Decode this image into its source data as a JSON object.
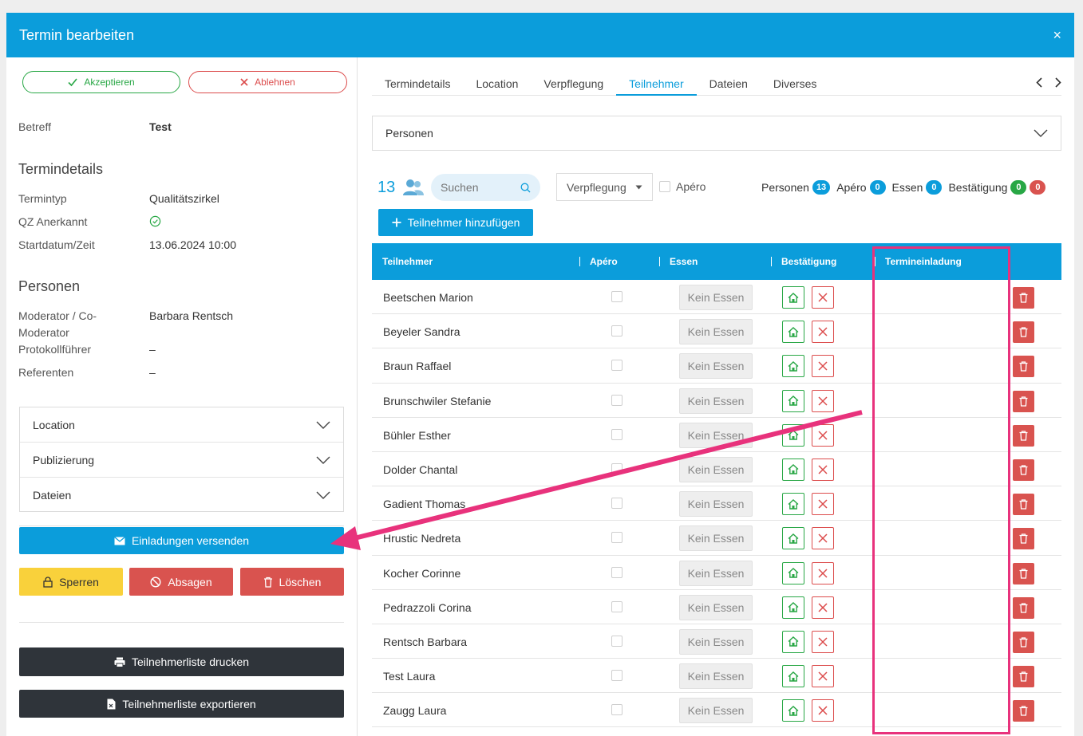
{
  "window": {
    "title": "Termin bearbeiten",
    "close_glyph": "×"
  },
  "actions": {
    "accept_label": "Akzeptieren",
    "reject_label": "Ablehnen"
  },
  "details": {
    "betreff_label": "Betreff",
    "betreff_value": "Test",
    "section_title": "Termindetails",
    "termintyp_label": "Termintyp",
    "termintyp_value": "Qualitätszirkel",
    "qz_label": "QZ Anerkannt",
    "start_label": "Startdatum/Zeit",
    "start_value": "13.06.2024 10:00"
  },
  "persons": {
    "section_title": "Personen",
    "moderator_label_1": "Moderator / Co-",
    "moderator_label_2": "Moderator",
    "moderator_value": "Barbara Rentsch",
    "protokoll_label": "Protokollführer",
    "protokoll_value": "–",
    "referenten_label": "Referenten",
    "referenten_value": "–"
  },
  "accordion": [
    "Location",
    "Publizierung",
    "Dateien"
  ],
  "buttons": {
    "invite": "Einladungen versenden",
    "lock": "Sperren",
    "cancel": "Absagen",
    "delete": "Löschen",
    "print": "Teilnehmerliste drucken",
    "export": "Teilnehmerliste exportieren"
  },
  "tabs": [
    "Termindetails",
    "Location",
    "Verpflegung",
    "Teilnehmer",
    "Dateien",
    "Diverses"
  ],
  "active_tab": "Teilnehmer",
  "personen_dropdown": "Personen",
  "toolbar": {
    "count": "13",
    "search_placeholder": "Suchen",
    "verpflegung_select": "Verpflegung",
    "apero_label": "Apéro",
    "add_button": "Teilnehmer hinzufügen"
  },
  "counters": {
    "personen_label": "Personen",
    "personen_count": "13",
    "apero_label": "Apéro",
    "apero_count": "0",
    "essen_label": "Essen",
    "essen_count": "0",
    "bestaetigung_label": "Bestätigung",
    "bestaetigung_yes": "0",
    "bestaetigung_no": "0"
  },
  "table": {
    "headers": [
      "Teilnehmer",
      "Apéro",
      "Essen",
      "Bestätigung",
      "Termineinladung"
    ],
    "essen_button": "Kein Essen",
    "rows": [
      "Beetschen Marion",
      "Beyeler Sandra",
      "Braun Raffael",
      "Brunschwiler Stefanie",
      "Bühler Esther",
      "Dolder Chantal",
      "Gadient Thomas",
      "Hrustic Nedreta",
      "Kocher Corinne",
      "Pedrazzoli Corina",
      "Rentsch Barbara",
      "Test Laura",
      "Zaugg Laura"
    ]
  },
  "colors": {
    "primary": "#0b9ddb",
    "success": "#28a745",
    "danger": "#d9534f",
    "warning": "#f9d13b",
    "dark": "#2f343a",
    "annotation": "#e8327c"
  }
}
